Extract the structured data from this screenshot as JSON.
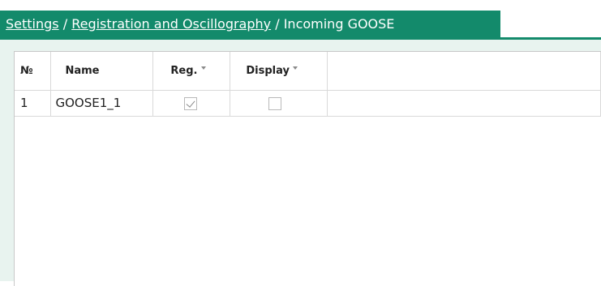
{
  "breadcrumb": {
    "items": [
      {
        "label": "Settings",
        "link": true
      },
      {
        "label": "Registration and Oscillography",
        "link": true
      },
      {
        "label": "Incoming GOOSE",
        "link": false
      }
    ],
    "separator": "/"
  },
  "table": {
    "columns": [
      {
        "label": "№",
        "filter": false
      },
      {
        "label": "Name",
        "filter": false
      },
      {
        "label": "Reg.",
        "filter": true
      },
      {
        "label": "Display",
        "filter": true
      }
    ],
    "rows": [
      {
        "num": "1",
        "name": "GOOSE1_1",
        "reg": true,
        "display": false
      }
    ]
  },
  "colors": {
    "accent": "#138a6b",
    "panel_bg": "#e8f3ef"
  }
}
